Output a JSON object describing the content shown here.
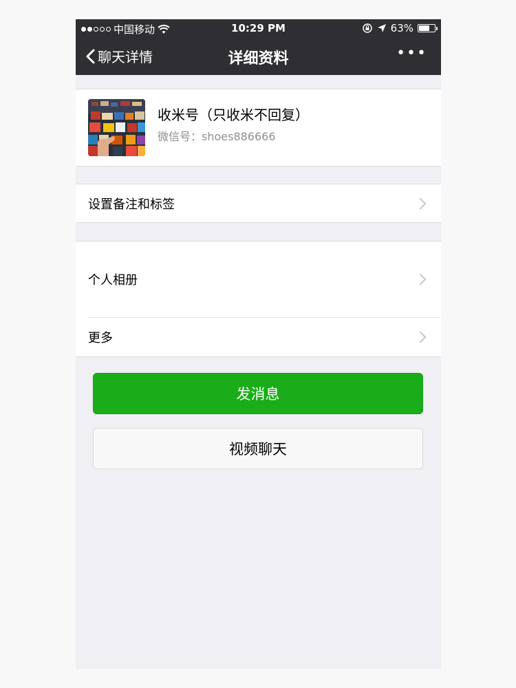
{
  "status": {
    "carrier": "中国移动",
    "time": "10:29 PM",
    "battery": "63%"
  },
  "nav": {
    "back_label": "聊天详情",
    "title": "详细资料",
    "more_label": "•••"
  },
  "profile": {
    "name": "收米号（只收米不回复）",
    "wechat_id": "微信号：shoes886666"
  },
  "menu": {
    "remark_tags": "设置备注和标签",
    "album": "个人相册",
    "more": "更多"
  },
  "buttons": {
    "send_message": "发消息",
    "video_call": "视频聊天"
  },
  "colors": {
    "nav_bg": "#2e2e33",
    "primary_green": "#1aad19",
    "page_bg": "#efeff4"
  }
}
